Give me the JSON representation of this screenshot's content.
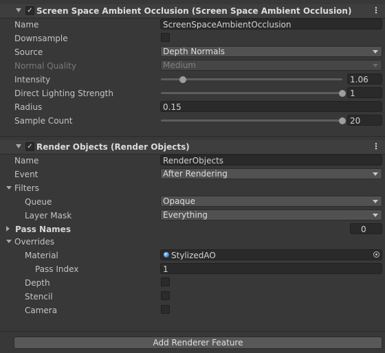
{
  "ssao": {
    "header_title": "Screen Space Ambient Occlusion (Screen Space Ambient Occlusion)",
    "checkbox": "✓",
    "fields": {
      "name_label": "Name",
      "name_value": "ScreenSpaceAmbientOcclusion",
      "downsample_label": "Downsample",
      "downsample_checked": false,
      "source_label": "Source",
      "source_value": "Depth Normals",
      "normal_quality_label": "Normal Quality",
      "normal_quality_value": "Medium",
      "intensity_label": "Intensity",
      "intensity_value": "1.06",
      "intensity_fraction": 0.12,
      "direct_lighting_label": "Direct Lighting Strength",
      "direct_lighting_value": "1",
      "direct_lighting_fraction": 1.0,
      "radius_label": "Radius",
      "radius_value": "0.15",
      "sample_count_label": "Sample Count",
      "sample_count_value": "20",
      "sample_count_fraction": 1.0
    }
  },
  "render_objects": {
    "header_title": "Render Objects (Render Objects)",
    "checkbox": "✓",
    "fields": {
      "name_label": "Name",
      "name_value": "RenderObjects",
      "event_label": "Event",
      "event_value": "After Rendering",
      "filters_label": "Filters",
      "queue_label": "Queue",
      "queue_value": "Opaque",
      "layer_mask_label": "Layer Mask",
      "layer_mask_value": "Everything",
      "pass_names_label": "Pass Names",
      "pass_names_value": "0",
      "overrides_label": "Overrides",
      "material_label": "Material",
      "material_value": "StylizedAO",
      "pass_index_label": "Pass Index",
      "pass_index_value": "1",
      "depth_label": "Depth",
      "stencil_label": "Stencil",
      "camera_label": "Camera"
    }
  },
  "menu_icon": "⋮",
  "add_renderer_feature_label": "Add Renderer Feature"
}
